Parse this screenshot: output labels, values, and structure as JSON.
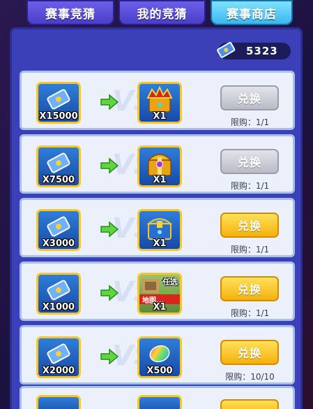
{
  "tabs": [
    {
      "label": "赛事竞猜",
      "active": false
    },
    {
      "label": "我的竞猜",
      "active": false
    },
    {
      "label": "赛事商店",
      "active": true
    }
  ],
  "balance": {
    "icon": "ticket-icon",
    "value": "5323"
  },
  "items": [
    {
      "cost_icon": "ticket-icon",
      "cost_qty": "X15000",
      "reward_icon": "gold-crown-chest-icon",
      "reward_qty": "X1",
      "button": "兑换",
      "button_state": "disabled",
      "limit": "限购：1/1"
    },
    {
      "cost_icon": "ticket-icon",
      "cost_qty": "X7500",
      "reward_icon": "purple-gem-chest-icon",
      "reward_qty": "X1",
      "button": "兑换",
      "button_state": "disabled",
      "limit": "限购：1/1"
    },
    {
      "cost_icon": "ticket-icon",
      "cost_qty": "X3000",
      "reward_icon": "blue-chest-icon",
      "reward_qty": "X1",
      "button": "兑换",
      "button_state": "enabled",
      "limit": "限购：1/1"
    },
    {
      "cost_icon": "ticket-icon",
      "cost_qty": "X1000",
      "reward_icon": "map-pack-icon",
      "reward_qty": "X1",
      "reward_tag": "任选",
      "reward_ribbon": "地图...",
      "button": "兑换",
      "button_state": "enabled",
      "limit": "限购：1/1"
    },
    {
      "cost_icon": "ticket-icon",
      "cost_qty": "X2000",
      "reward_icon": "rainbow-bean-icon",
      "reward_qty": "X500",
      "button": "兑换",
      "button_state": "enabled",
      "limit": "限购：10/10"
    }
  ],
  "watermark": "VS",
  "colors": {
    "enabled_button": "#f5b10c",
    "disabled_button": "#b9bcc6",
    "panel": "#3b3fb8",
    "active_tab": "#3cb6ef"
  }
}
